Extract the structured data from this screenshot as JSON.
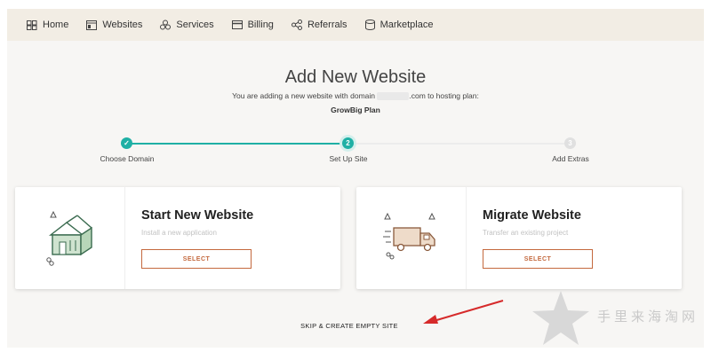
{
  "nav": {
    "items": [
      {
        "label": "Home",
        "icon": "home-icon"
      },
      {
        "label": "Websites",
        "icon": "websites-icon"
      },
      {
        "label": "Services",
        "icon": "services-icon"
      },
      {
        "label": "Billing",
        "icon": "billing-icon"
      },
      {
        "label": "Referrals",
        "icon": "referrals-icon"
      },
      {
        "label": "Marketplace",
        "icon": "marketplace-icon"
      }
    ]
  },
  "page": {
    "title": "Add New Website",
    "subtitle_before": "You are adding a new website with domain",
    "subtitle_domain_tail": ".com",
    "subtitle_after": "to hosting plan:",
    "plan": "GrowBig Plan"
  },
  "steps": [
    {
      "label": "Choose Domain",
      "state": "done",
      "marker": "✓"
    },
    {
      "label": "Set Up Site",
      "state": "active",
      "marker": "2"
    },
    {
      "label": "Add Extras",
      "state": "pending",
      "marker": "3"
    }
  ],
  "cards": [
    {
      "title": "Start New Website",
      "description": "Install a new application",
      "button": "SELECT",
      "icon": "house-icon"
    },
    {
      "title": "Migrate Website",
      "description": "Transfer an existing project",
      "button": "SELECT",
      "icon": "moving-truck-icon"
    }
  ],
  "skip_link": "SKIP & CREATE EMPTY SITE",
  "watermark": "手里来海淘网",
  "colors": {
    "accent": "#c4693e",
    "step_done": "#1fb0a5",
    "nav_bg": "#f2ede4",
    "annotation_arrow": "#d62a2a"
  }
}
